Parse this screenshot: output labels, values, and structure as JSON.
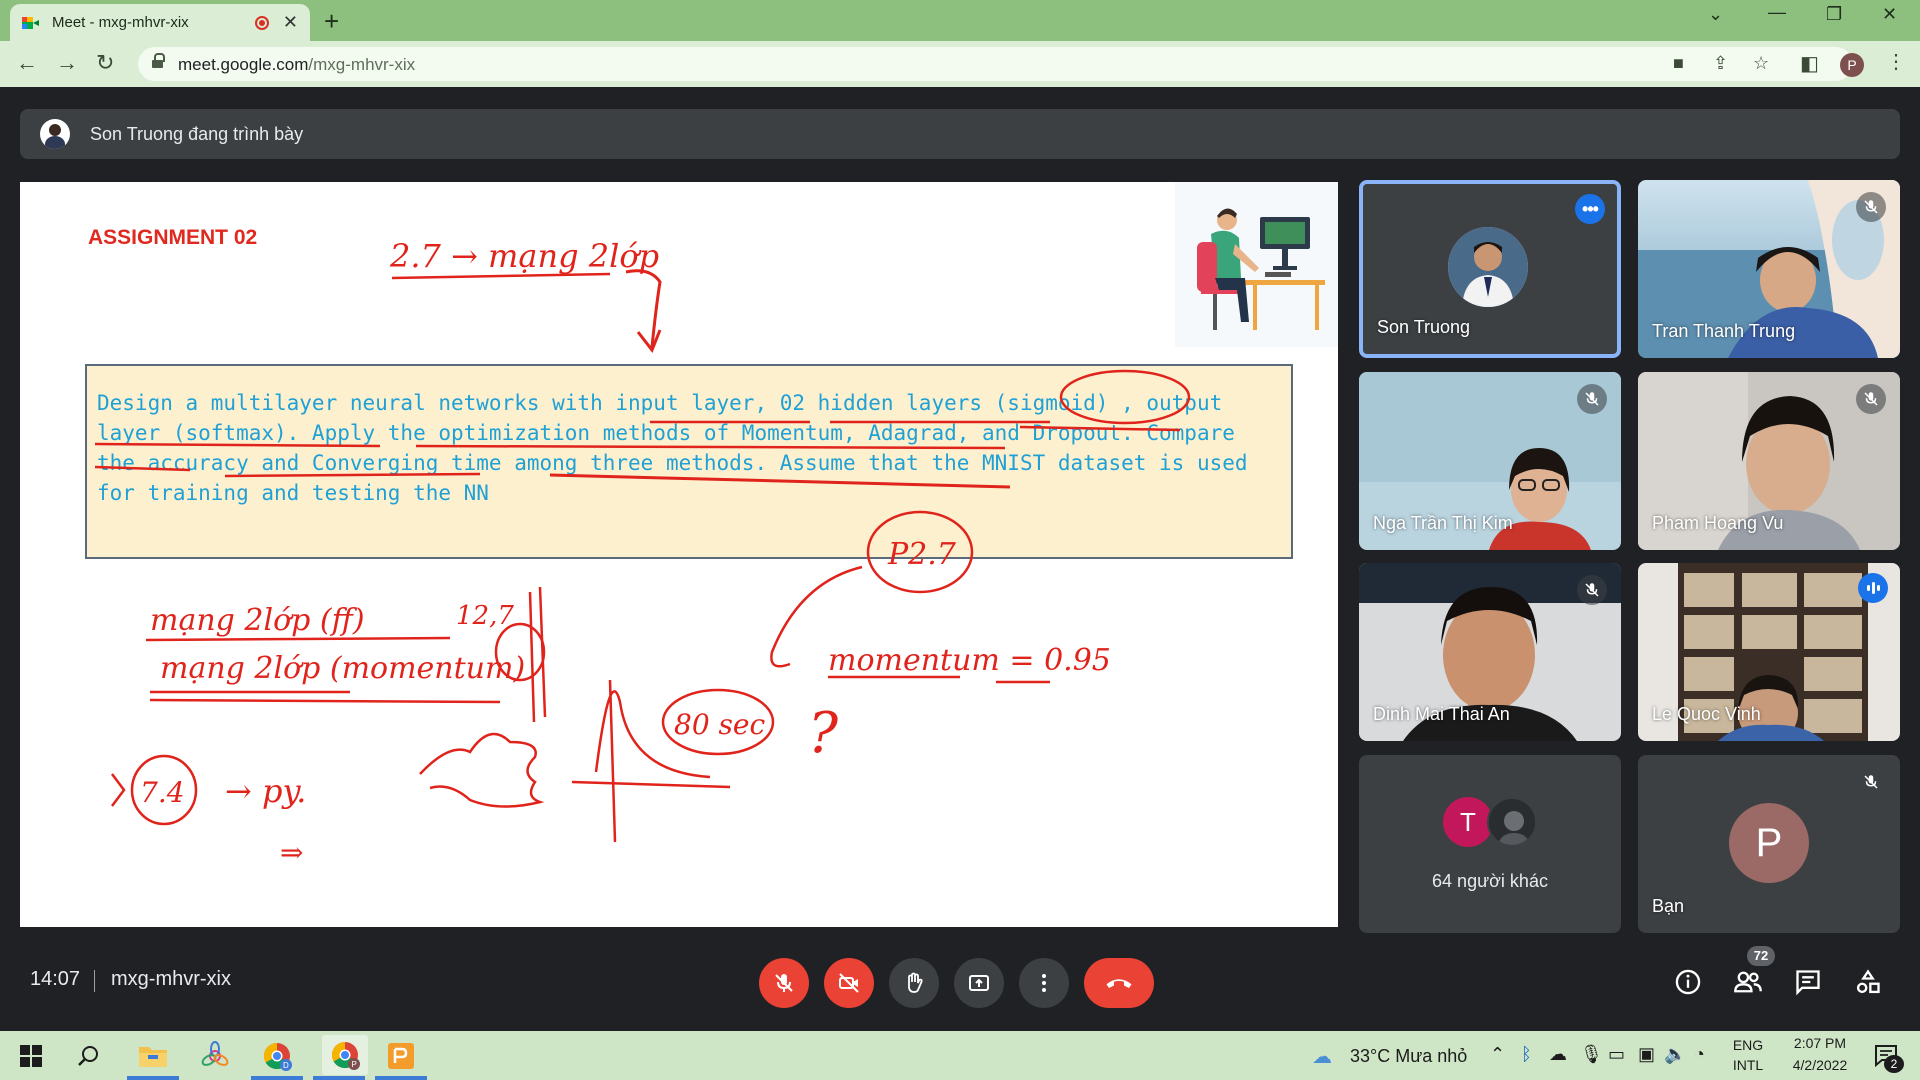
{
  "browser": {
    "tab_title": "Meet - mxg-mhvr-xix",
    "url_host": "meet.google.com",
    "url_path": "/mxg-mhvr-xix",
    "profile_initial": "P"
  },
  "presenter_banner": {
    "text": "Son Truong đang trình bày"
  },
  "slide": {
    "title": "ASSIGNMENT 02",
    "task": "Design a multilayer neural networks with input layer, 02 hidden layers (sigmoid) , output layer (softmax). Apply the optimization methods of Momentum, Adagrad, and Dropout. Compare the accuracy and Converging time among three methods. Assume that the MNIST dataset is used for training and testing the NN",
    "annotations": {
      "top_note": "2.7 → mạng 2lớp",
      "circle_note": "P2.7",
      "line1": "mạng 2lớp (ff)",
      "line2": "mạng 2lớp (momentum)",
      "num_12": "12,7",
      "momentum": "momentum = 0.95",
      "seconds": "80 sec",
      "question": "?",
      "circle_74": "7.4",
      "py": "→ py.",
      "arrow": "⇒"
    }
  },
  "participants": [
    {
      "name": "Son Truong",
      "status": "presenting"
    },
    {
      "name": "Tran Thanh Trung",
      "status": "muted"
    },
    {
      "name": "Nga Trần Thị Kim",
      "status": "muted"
    },
    {
      "name": "Pham Hoang Vu",
      "status": "muted"
    },
    {
      "name": "Dinh Mai Thai An",
      "status": "muted"
    },
    {
      "name": "Le Quoc Vinh",
      "status": "speaking"
    }
  ],
  "others_tile": {
    "avatar_initial": "T",
    "label": "64 người khác"
  },
  "self_tile": {
    "avatar_initial": "P",
    "name": "Bạn"
  },
  "controls": {
    "time": "14:07",
    "meeting_code": "mxg-mhvr-xix",
    "people_count": "72"
  },
  "taskbar": {
    "weather": "33°C  Mưa nhỏ",
    "lang_top": "ENG",
    "lang_bottom": "INTL",
    "time": "2:07 PM",
    "date": "4/2/2022",
    "notif_count": "2"
  },
  "colors": {
    "meet_bg": "#202124",
    "tile_bg": "#3c4043",
    "end_call": "#ea4335",
    "accent_blue": "#1a73e8",
    "ink_red": "#e0231b",
    "task_text": "#1fa1d6",
    "chrome_green": "#8dc07e"
  }
}
